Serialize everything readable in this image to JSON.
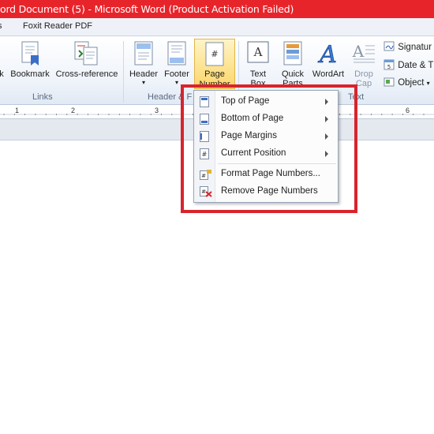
{
  "window": {
    "title": "ord Document (5)  -  Microsoft Word (Product Activation Failed)",
    "title_bar_color": "#e8242b"
  },
  "tabs": {
    "partial_tab": "s",
    "foxit": "Foxit Reader PDF"
  },
  "ribbon": {
    "links_group": {
      "partial_button": "k",
      "bookmark": "Bookmark",
      "cross_reference": "Cross-reference",
      "group_label": "Links"
    },
    "header_footer_group": {
      "header": "Header",
      "footer": "Footer",
      "page_number_line1": "Page",
      "page_number_line2": "Number",
      "group_label": "Header & F"
    },
    "text_group": {
      "text_box_line1": "Text",
      "text_box_line2": "Box",
      "quick_parts_line1": "Quick",
      "quick_parts_line2": "Parts",
      "wordart": "WordArt",
      "drop_cap_line1": "Drop",
      "drop_cap_line2": "Cap",
      "group_label": "Text",
      "signature_line": "Signatur",
      "date_time": "Date & T",
      "object": "Object"
    }
  },
  "ruler": {
    "numbers": [
      "1",
      "2",
      "3",
      "6"
    ]
  },
  "page_number_menu": {
    "items": [
      {
        "label": "Top of Page",
        "has_submenu": true
      },
      {
        "label": "Bottom of Page",
        "has_submenu": true
      },
      {
        "label": "Page Margins",
        "has_submenu": true
      },
      {
        "label": "Current Position",
        "has_submenu": true
      },
      {
        "label": "Format Page Numbers...",
        "has_submenu": false
      },
      {
        "label": "Remove Page Numbers",
        "has_submenu": false
      }
    ]
  },
  "annotation": {
    "highlight_color": "#d8242c"
  },
  "colors": {
    "accent_selected_button": "#fde79c",
    "ribbon_bg": "#eef3fa"
  }
}
